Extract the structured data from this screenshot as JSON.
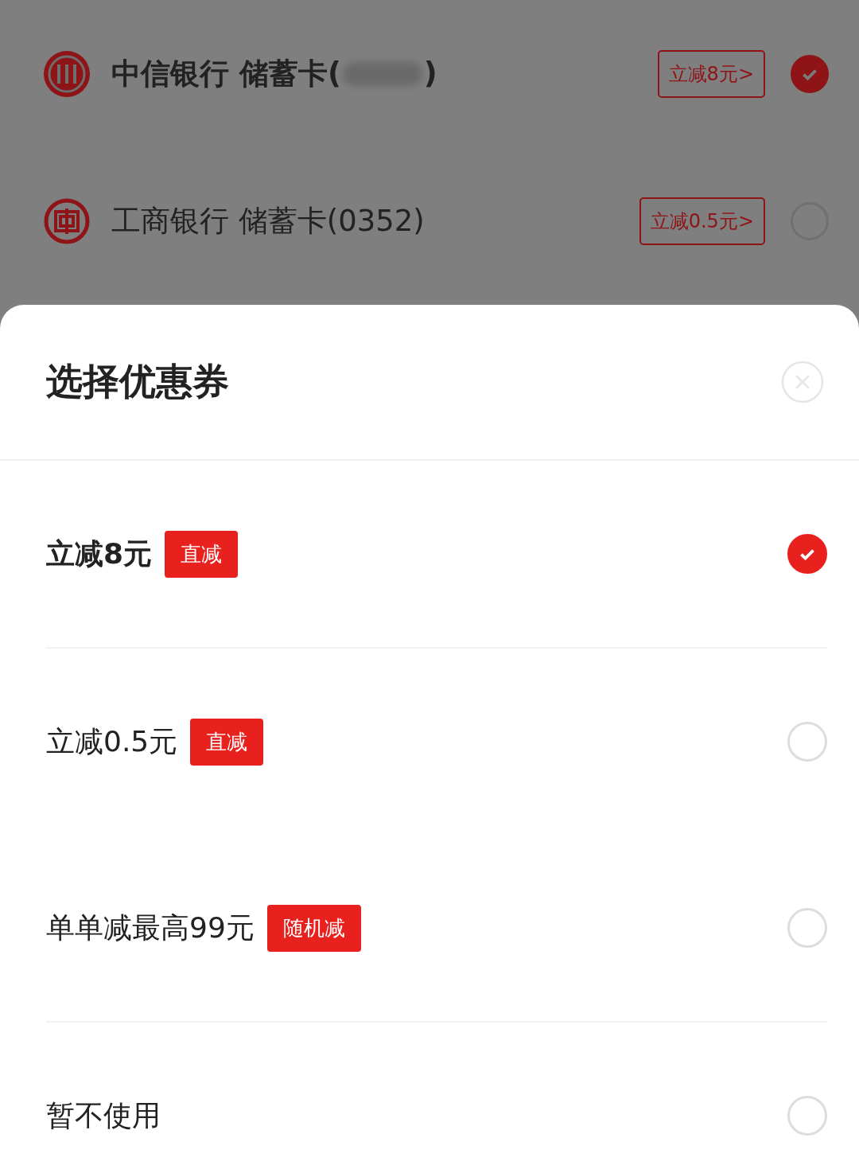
{
  "bank_cards": [
    {
      "kind": "citic",
      "name": "中信银行 储蓄卡(",
      "name_after": ")",
      "discount": "立减8元>",
      "selected": true
    },
    {
      "kind": "icbc",
      "name": "工商银行 储蓄卡(0352)",
      "discount": "立减0.5元>",
      "selected": false
    }
  ],
  "sheet": {
    "title": "选择优惠券",
    "coupon_groups": [
      [
        {
          "label": "立减8元",
          "tag": "直减",
          "selected": true
        }
      ],
      [
        {
          "label": "立减0.5元",
          "tag": "直减",
          "selected": false
        },
        {
          "label": "单单减最高99元",
          "tag": "随机减",
          "selected": false
        }
      ],
      [
        {
          "label": "暂不使用",
          "selected": false
        }
      ]
    ]
  }
}
